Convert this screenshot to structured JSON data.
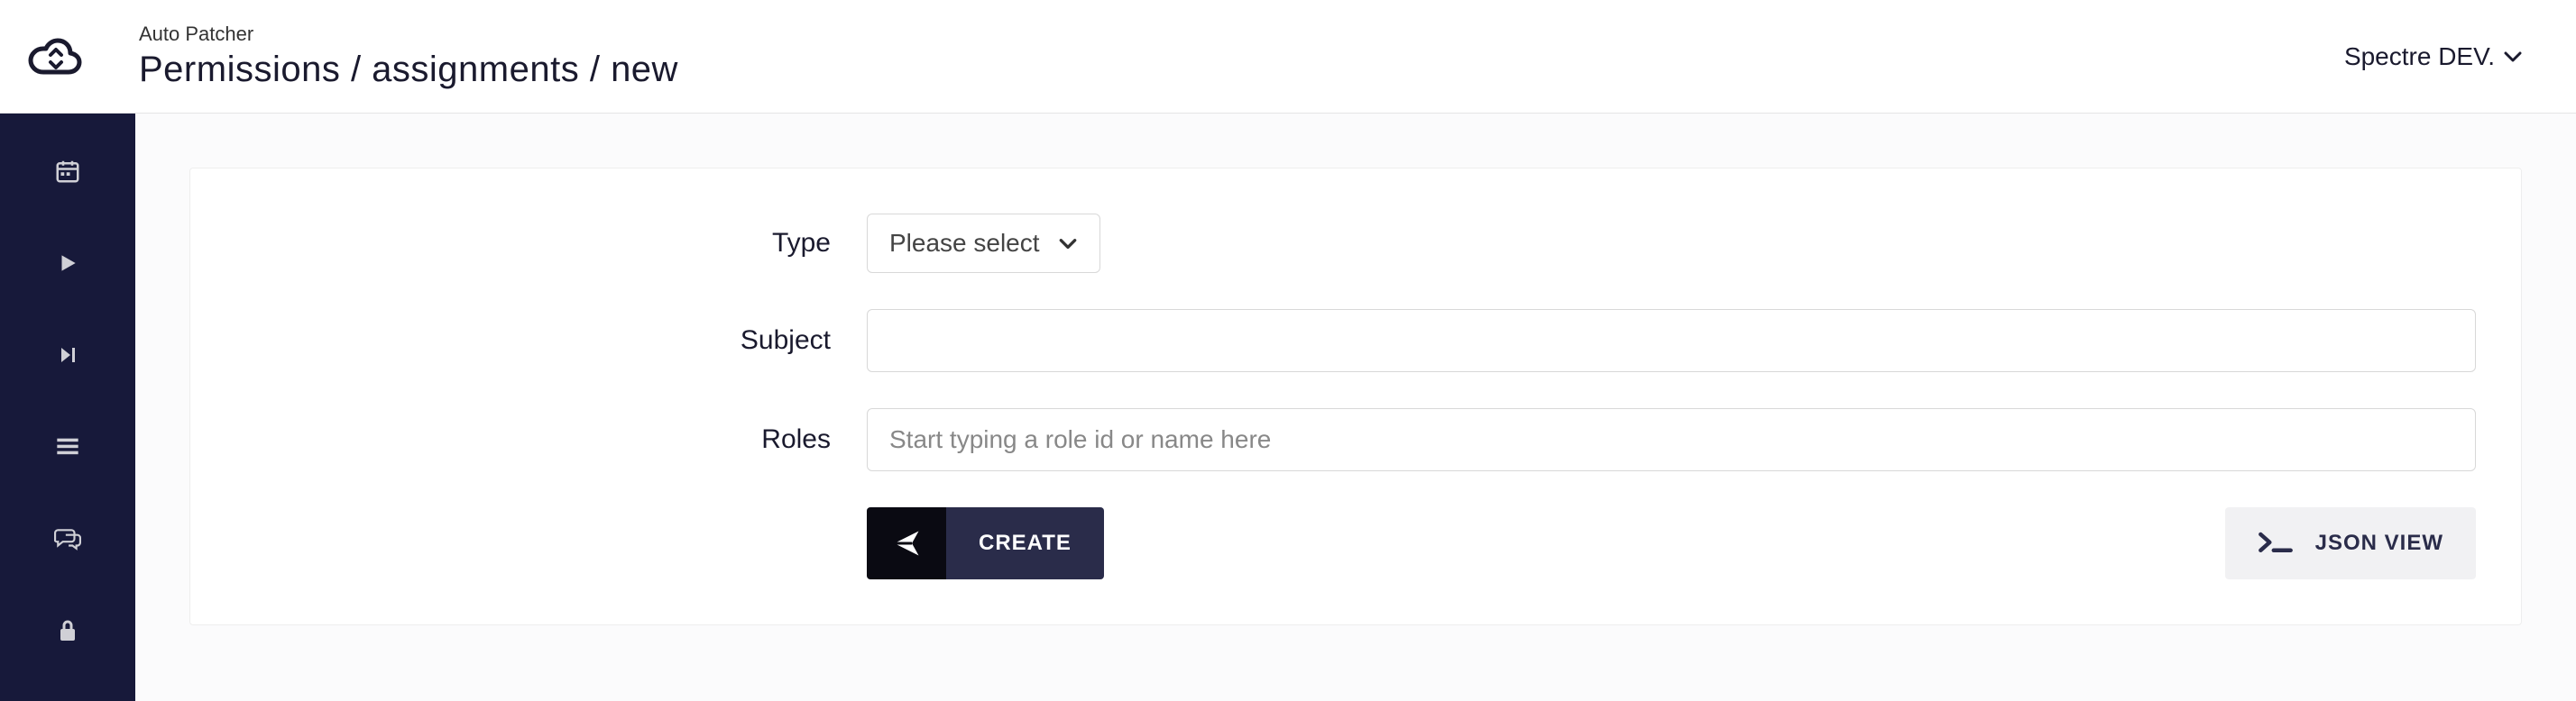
{
  "header": {
    "app_name": "Auto Patcher",
    "breadcrumb": "Permissions / assignments / new",
    "org_name": "Spectre DEV."
  },
  "sidebar": {
    "items": [
      {
        "name": "calendar"
      },
      {
        "name": "play"
      },
      {
        "name": "step-forward"
      },
      {
        "name": "list"
      },
      {
        "name": "chat"
      },
      {
        "name": "lock"
      }
    ]
  },
  "form": {
    "type": {
      "label": "Type",
      "placeholder_text": "Please select"
    },
    "subject": {
      "label": "Subject",
      "value": ""
    },
    "roles": {
      "label": "Roles",
      "placeholder": "Start typing a role id or name here"
    }
  },
  "buttons": {
    "create": "CREATE",
    "json_view": "JSON VIEW"
  }
}
